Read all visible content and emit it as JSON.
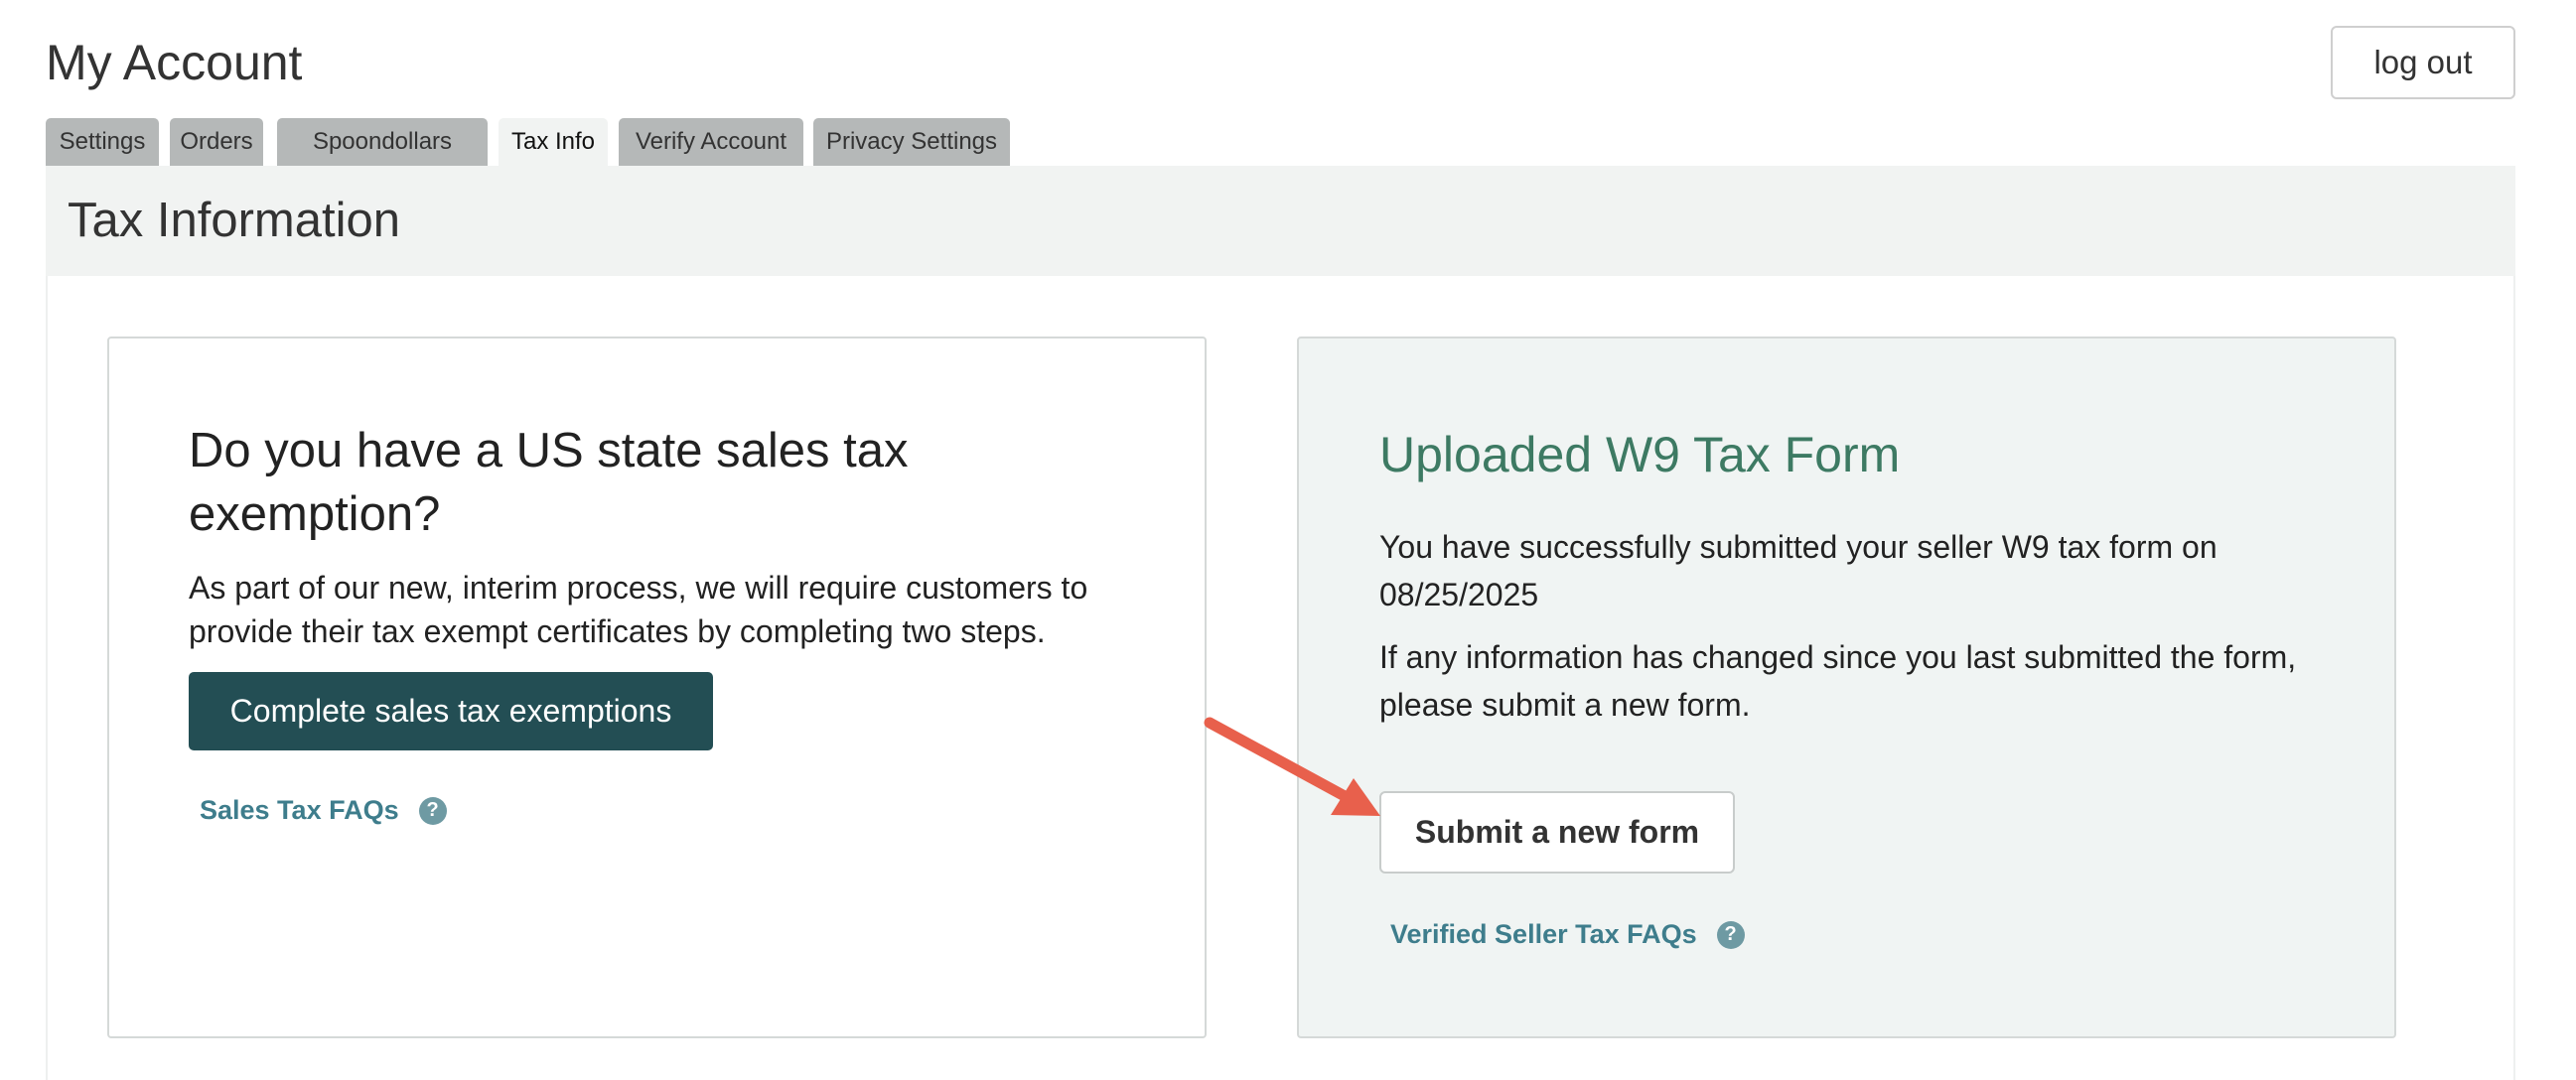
{
  "header": {
    "title": "My Account",
    "logout_label": "log out"
  },
  "tabs": [
    {
      "label": "Settings",
      "active": false
    },
    {
      "label": "Orders",
      "active": false
    },
    {
      "label": "Spoondollars",
      "active": false
    },
    {
      "label": "Tax Info",
      "active": true
    },
    {
      "label": "Verify Account",
      "active": false
    },
    {
      "label": "Privacy Settings",
      "active": false
    }
  ],
  "section": {
    "title": "Tax Information"
  },
  "exemption_card": {
    "heading": "Do you have a US state sales tax exemption?",
    "description": "As part of our new, interim process, we will require customers to provide their tax exempt certificates by completing two steps.",
    "button_label": "Complete sales tax exemptions",
    "faq_label": "Sales Tax FAQs",
    "help_icon": "question-mark-circle-icon"
  },
  "w9_card": {
    "heading": "Uploaded W9 Tax Form",
    "submitted_text": "You have successfully submitted your seller W9 tax form on 08/25/2025",
    "changed_text": "If any information has changed since you last submitted the form, please submit a new form.",
    "button_label": "Submit a new form",
    "faq_label": "Verified Seller Tax FAQs",
    "help_icon": "question-mark-circle-icon"
  },
  "colors": {
    "primary_button": "#234e54",
    "link": "#3e7d8c",
    "w9_heading": "#3d7a63",
    "annotation_arrow": "#e8604c",
    "tab_inactive": "#b5b8b8",
    "panel_background": "#f1f3f2"
  }
}
